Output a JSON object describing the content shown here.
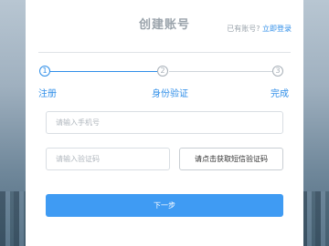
{
  "header": {
    "title": "创建账号",
    "login_prompt": "已有账号?",
    "login_link": "立即登录"
  },
  "steps": [
    {
      "number": "1",
      "label": "注册"
    },
    {
      "number": "2",
      "label": "身份验证"
    },
    {
      "number": "3",
      "label": "完成"
    }
  ],
  "form": {
    "phone_placeholder": "请输入手机号",
    "code_placeholder": "请输入验证码",
    "get_code_label": "请点击获取短信验证码",
    "next_label": "下一步"
  },
  "colors": {
    "accent": "#2f8ee8",
    "button": "#3f9bf3"
  }
}
